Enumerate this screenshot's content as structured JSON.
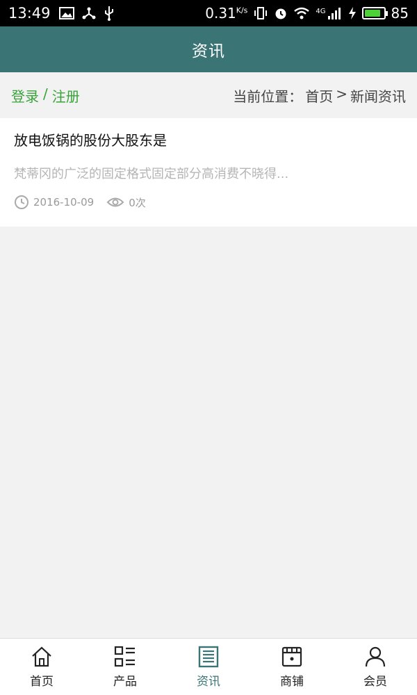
{
  "status_bar": {
    "time": "13:49",
    "net_speed": "0.31",
    "net_speed_unit": "K/s",
    "network_label": "4G",
    "battery_level": "85",
    "battery_fraction": 0.85
  },
  "header": {
    "title": "资讯"
  },
  "crumb": {
    "login": "登录",
    "separator": "/",
    "register": "注册",
    "location_label": "当前位置：",
    "home": "首页",
    "arrow": ">",
    "current": "新闻资讯"
  },
  "news": [
    {
      "title": "放电饭锅的股份大股东是",
      "summary": "梵蒂冈的广泛的固定格式固定部分高消费不晓得...",
      "date": "2016-10-09",
      "views": "0次"
    }
  ],
  "bottom_nav": {
    "active_color": "#3b7475",
    "items": [
      {
        "label": "首页",
        "icon": "home-icon"
      },
      {
        "label": "产品",
        "icon": "list-icon"
      },
      {
        "label": "资讯",
        "icon": "news-icon"
      },
      {
        "label": "商铺",
        "icon": "shop-icon"
      },
      {
        "label": "会员",
        "icon": "user-icon"
      }
    ]
  },
  "colors": {
    "header_bg": "#3b7475",
    "auth_green": "#3aa23a"
  }
}
